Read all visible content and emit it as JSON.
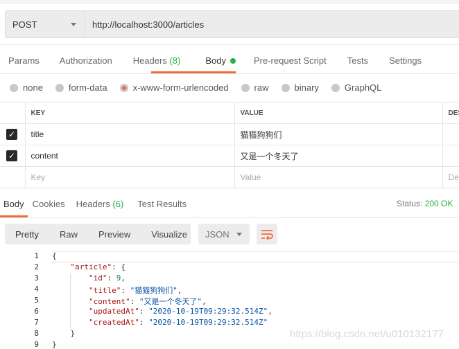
{
  "request": {
    "method": "POST",
    "url": "http://localhost:3000/articles"
  },
  "tabs": [
    {
      "label": "Params"
    },
    {
      "label": "Authorization"
    },
    {
      "label": "Headers",
      "count": "(8)"
    },
    {
      "label": "Body"
    },
    {
      "label": "Pre-request Script"
    },
    {
      "label": "Tests"
    },
    {
      "label": "Settings"
    }
  ],
  "body_types": [
    {
      "label": "none"
    },
    {
      "label": "form-data"
    },
    {
      "label": "x-www-form-urlencoded",
      "selected": true
    },
    {
      "label": "raw"
    },
    {
      "label": "binary"
    },
    {
      "label": "GraphQL"
    }
  ],
  "table": {
    "headers": [
      "KEY",
      "VALUE",
      "DES"
    ],
    "rows": [
      {
        "key": "title",
        "value": "猫猫狗狗们",
        "checked": true
      },
      {
        "key": "content",
        "value": "又是一个冬天了",
        "checked": true
      }
    ],
    "placeholder": {
      "key": "Key",
      "value": "Value",
      "desc": "De"
    }
  },
  "response": {
    "tabs": [
      {
        "label": "Body"
      },
      {
        "label": "Cookies"
      },
      {
        "label": "Headers",
        "count": "(6)"
      },
      {
        "label": "Test Results"
      }
    ],
    "status_label": "Status:",
    "status_value": "200 OK",
    "views": [
      "Pretty",
      "Raw",
      "Preview",
      "Visualize"
    ],
    "format": "JSON",
    "lines": [
      "1",
      "2",
      "3",
      "4",
      "5",
      "6",
      "7",
      "8",
      "9"
    ],
    "json": {
      "article_key": "\"article\"",
      "id_key": "\"id\"",
      "id": "9",
      "title_key": "\"title\"",
      "title": "\"猫猫狗狗们\"",
      "content_key": "\"content\"",
      "content": "\"又是一个冬天了\"",
      "updated_key": "\"updatedAt\"",
      "updated": "\"2020-10-19T09:29:32.514Z\"",
      "created_key": "\"createdAt\"",
      "created": "\"2020-10-19T09:29:32.514Z\""
    }
  },
  "watermark": "https://blog.csdn.net/u010132177",
  "colors": {
    "accent": "#f26b3a",
    "green": "#26b047"
  }
}
